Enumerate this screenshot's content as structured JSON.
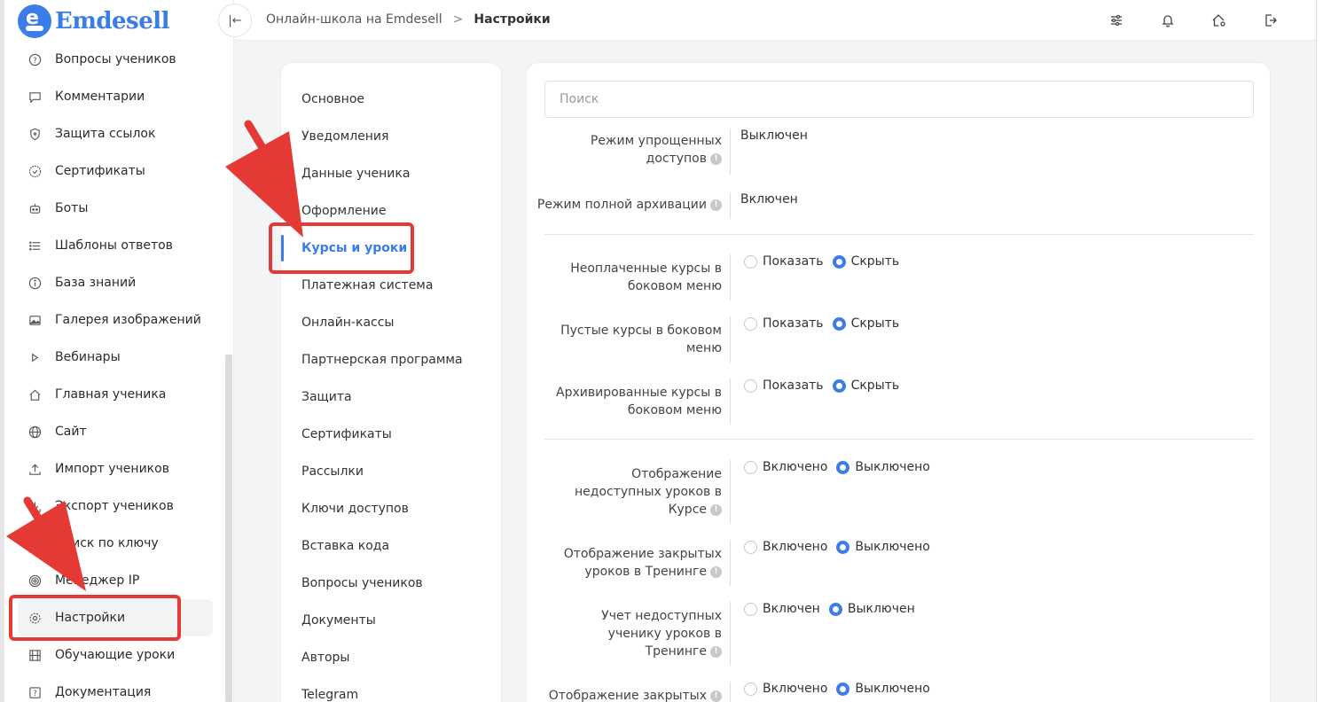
{
  "app": {
    "logo_text": "Emdesell",
    "logo_letter": "e"
  },
  "breadcrumb": {
    "root": "Онлайн-школа на Emdesell",
    "separator": ">",
    "current": "Настройки"
  },
  "topbar_icons": [
    "sliders-icon",
    "bell-icon",
    "home-settings-icon",
    "logout-icon"
  ],
  "sidebar": {
    "items": [
      {
        "label": "Вопросы учеников",
        "icon": "question-circle-icon"
      },
      {
        "label": "Комментарии",
        "icon": "comment-icon"
      },
      {
        "label": "Защита ссылок",
        "icon": "shield-icon"
      },
      {
        "label": "Сертификаты",
        "icon": "certificate-icon"
      },
      {
        "label": "Боты",
        "icon": "bot-icon"
      },
      {
        "label": "Шаблоны ответов",
        "icon": "list-icon"
      },
      {
        "label": "База знаний",
        "icon": "info-circle-icon"
      },
      {
        "label": "Галерея изображений",
        "icon": "image-icon"
      },
      {
        "label": "Вебинары",
        "icon": "play-icon"
      },
      {
        "label": "Главная ученика",
        "icon": "home-icon"
      },
      {
        "label": "Сайт",
        "icon": "globe-icon"
      },
      {
        "label": "Импорт учеников",
        "icon": "upload-icon"
      },
      {
        "label": "Экспорт учеников",
        "icon": "download-icon"
      },
      {
        "label": "Поиск по ключу",
        "icon": "key-icon"
      },
      {
        "label": "Менеджер IP",
        "icon": "target-icon"
      },
      {
        "label": "Настройки",
        "icon": "gear-icon",
        "active": true
      },
      {
        "label": "Обучающие уроки",
        "icon": "film-icon"
      },
      {
        "label": "Документация",
        "icon": "help-box-icon"
      }
    ]
  },
  "settings_menu": {
    "items": [
      {
        "label": "Основное"
      },
      {
        "label": "Уведомления"
      },
      {
        "label": "Данные ученика"
      },
      {
        "label": "Оформление"
      },
      {
        "label": "Курсы и уроки",
        "active": true
      },
      {
        "label": "Платежная система"
      },
      {
        "label": "Онлайн-кассы"
      },
      {
        "label": "Партнерская программа"
      },
      {
        "label": "Защита"
      },
      {
        "label": "Сертификаты"
      },
      {
        "label": "Рассылки"
      },
      {
        "label": "Ключи доступов"
      },
      {
        "label": "Вставка кода"
      },
      {
        "label": "Вопросы учеников"
      },
      {
        "label": "Документы"
      },
      {
        "label": "Авторы"
      },
      {
        "label": "Telegram"
      }
    ]
  },
  "content": {
    "search_placeholder": "Поиск",
    "settings": [
      {
        "label_lines": [
          "Режим упрощенных",
          "доступов"
        ],
        "info": true,
        "value": "Выключен"
      },
      {
        "label_lines": [
          "Режим полной архивации"
        ],
        "info": true,
        "value": "Включен"
      },
      {
        "label_lines": [
          "Неоплаченные курсы в",
          "боковом меню"
        ],
        "info": false,
        "options": [
          "Показать",
          "Скрыть"
        ],
        "selected": 1
      },
      {
        "label_lines": [
          "Пустые курсы в боковом",
          "меню"
        ],
        "info": false,
        "options": [
          "Показать",
          "Скрыть"
        ],
        "selected": 1
      },
      {
        "label_lines": [
          "Архивированные курсы в",
          "боковом меню"
        ],
        "info": false,
        "options": [
          "Показать",
          "Скрыть"
        ],
        "selected": 1
      },
      {
        "label_lines": [
          "Отображение",
          "недоступных уроков в",
          "Курсе"
        ],
        "info": true,
        "options": [
          "Включено",
          "Выключено"
        ],
        "selected": 1
      },
      {
        "label_lines": [
          "Отображение закрытых",
          "уроков в Тренинге"
        ],
        "info": true,
        "options": [
          "Включено",
          "Выключено"
        ],
        "selected": 1
      },
      {
        "label_lines": [
          "Учет недоступных",
          "ученику уроков в",
          "Тренинге"
        ],
        "info": true,
        "options": [
          "Включен",
          "Выключен"
        ],
        "selected": 1
      },
      {
        "label_lines": [
          "Отображение закрытых"
        ],
        "info": true,
        "options": [
          "Включено",
          "Выключено"
        ],
        "selected": 1
      }
    ]
  },
  "colors": {
    "accent": "#3b7de8",
    "annotation": "#e53935"
  }
}
